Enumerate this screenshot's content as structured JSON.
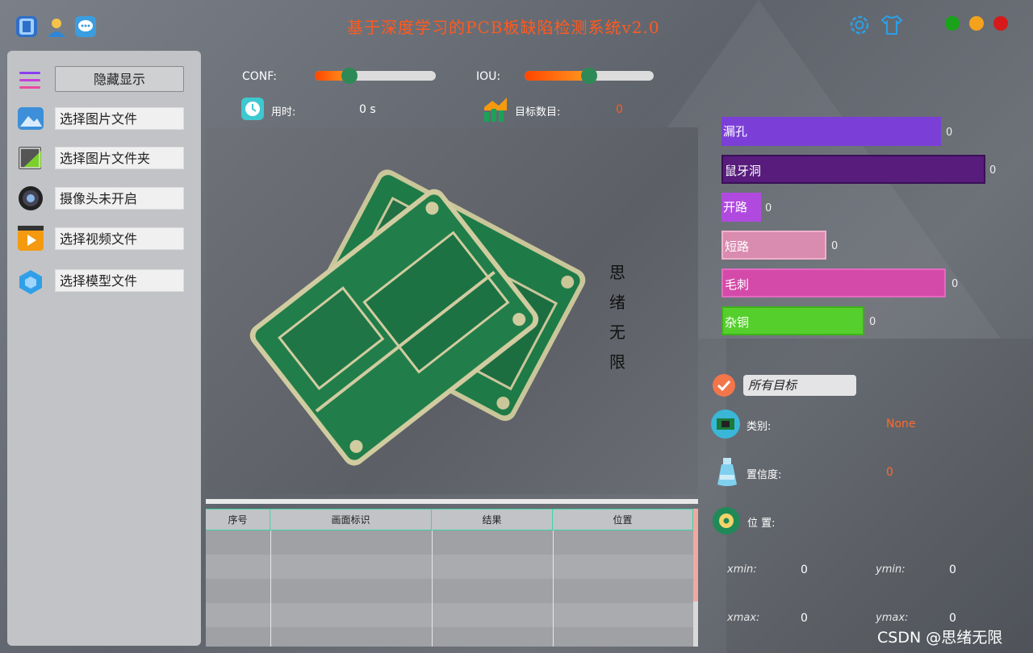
{
  "app": {
    "title": "基于深度学习的PCB板缺陷检测系统v2.0",
    "colors": {
      "title": "#ff5a1f",
      "accent": "#2d8a57",
      "value": "#ff6a2a"
    }
  },
  "titlebar": {
    "left_icons": [
      "app-icon",
      "user-icon",
      "chat-icon"
    ],
    "right_icons": [
      "gear-icon",
      "shirt-icon"
    ],
    "window_dots": [
      {
        "name": "maximize",
        "color": "#1aa31a"
      },
      {
        "name": "minimize",
        "color": "#f4a21c"
      },
      {
        "name": "close",
        "color": "#d61a1a"
      }
    ]
  },
  "sidebar": {
    "toggle_label": "隐藏显示",
    "items": [
      {
        "label": "选择图片文件",
        "icon": "image-icon"
      },
      {
        "label": "选择图片文件夹",
        "icon": "folder-icon"
      },
      {
        "label": "摄像头未开启",
        "icon": "camera-icon"
      },
      {
        "label": "选择视频文件",
        "icon": "video-icon"
      },
      {
        "label": "选择模型文件",
        "icon": "model-icon"
      }
    ]
  },
  "controls": {
    "conf_label": "CONF:",
    "conf_value": 0.29,
    "iou_label": "IOU:",
    "iou_value": 0.5,
    "time_label": "用时:",
    "time_value": "0 s",
    "count_label": "目标数目:",
    "count_value": "0"
  },
  "image": {
    "vertical_text": [
      "思",
      "绪",
      "无",
      "限"
    ]
  },
  "table": {
    "columns": [
      "序号",
      "画面标识",
      "结果",
      "位置"
    ],
    "rows": [
      [
        "",
        "",
        "",
        ""
      ],
      [
        "",
        "",
        "",
        ""
      ],
      [
        "",
        "",
        "",
        ""
      ],
      [
        "",
        "",
        "",
        ""
      ],
      [
        "",
        "",
        "",
        ""
      ]
    ]
  },
  "defects": {
    "bars": [
      {
        "label": "漏孔",
        "value": "0",
        "color": "#7b3fd8"
      },
      {
        "label": "鼠牙洞",
        "value": "0",
        "color": "#571c7c"
      },
      {
        "label": "开路",
        "value": "0",
        "color": "#b04ade"
      },
      {
        "label": "短路",
        "value": "0",
        "color": "#d98bb0"
      },
      {
        "label": "毛刺",
        "value": "0",
        "color": "#d44aa8"
      },
      {
        "label": "杂铜",
        "value": "0",
        "color": "#55cf2c"
      }
    ]
  },
  "detail": {
    "target_select": "所有目标",
    "class_label": "类别:",
    "class_value": "None",
    "confidence_label": "置信度:",
    "confidence_value": "0",
    "position_label": "位 置:",
    "xmin_label": "xmin:",
    "xmin_value": "0",
    "ymin_label": "ymin:",
    "ymin_value": "0",
    "xmax_label": "xmax:",
    "xmax_value": "0",
    "ymax_label": "ymax:",
    "ymax_value": "0"
  },
  "watermark": "CSDN @思绪无限"
}
